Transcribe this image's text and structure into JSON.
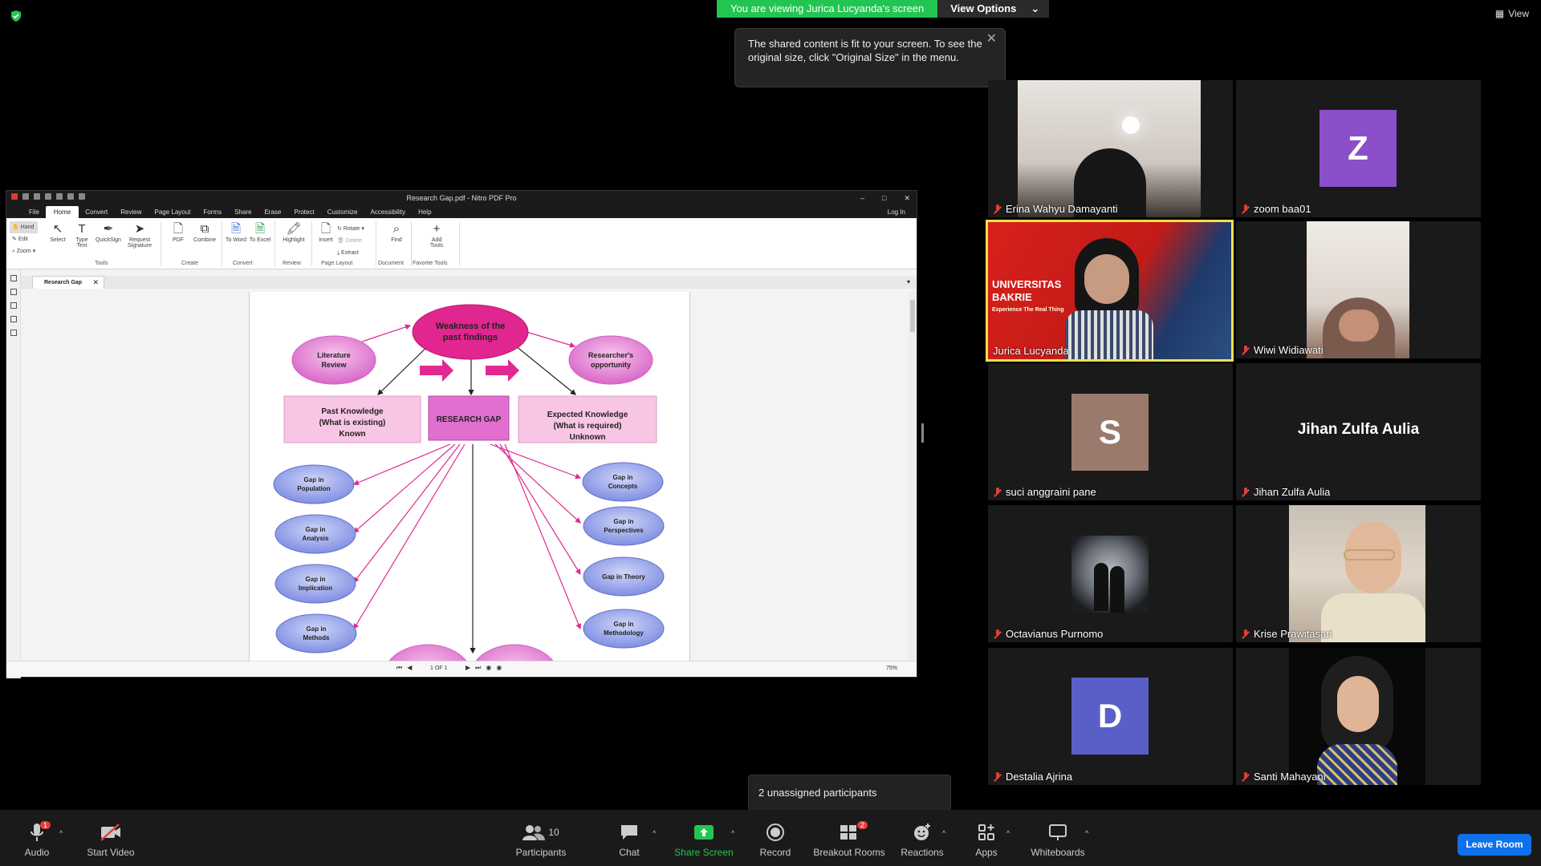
{
  "banner": {
    "viewing_text": "You are viewing Jurica Lucyanda's screen",
    "view_options": "View Options"
  },
  "tooltip": {
    "text": "The shared content is fit to your screen. To see the original size, click \"Original Size\" in the menu."
  },
  "top_right": {
    "view_label": "View"
  },
  "nitro": {
    "title": "Research Gap.pdf - Nitro PDF Pro",
    "menu": [
      "File",
      "Home",
      "Convert",
      "Review",
      "Page Layout",
      "Forms",
      "Share",
      "Erase",
      "Protect",
      "Customize",
      "Accessibility",
      "Help"
    ],
    "login": "Log In",
    "left_tools": [
      "Hand",
      "Edit",
      "Zoom"
    ],
    "ribbon": {
      "select": "Select",
      "type_text": "Type Text",
      "quicksign": "QuickSign",
      "request_signature": "Request Signature",
      "pdf": "PDF",
      "combine": "Combine",
      "to_word": "To Word",
      "to_excel": "To Excel",
      "highlight": "Highlight",
      "insert": "Insert",
      "rotate": "Rotate",
      "delete": "Delete",
      "extract": "Extract",
      "find": "Find",
      "add_tools": "Add Tools"
    },
    "groups": {
      "tools": "Tools",
      "create": "Create",
      "convert": "Convert",
      "review": "Review",
      "page_layout": "Page Layout",
      "document": "Document",
      "favorite_tools": "Favorite Tools"
    },
    "tab_name": "Research Gap",
    "page_indicator": "1 OF 1",
    "zoom": "75%",
    "diagram": {
      "weakness": [
        "Weakness of the",
        "past findings"
      ],
      "literature": [
        "Literature",
        "Review"
      ],
      "researcher": [
        "Researcher's",
        "opportunity"
      ],
      "past_knowledge": [
        "Past Knowledge",
        "(What is existing)",
        "Known"
      ],
      "research_gap": "RESEARCH GAP",
      "expected": [
        "Expected Knowledge",
        "(What is required)",
        "Unknown"
      ],
      "left_gaps": [
        [
          "Gap in",
          "Population"
        ],
        [
          "Gap in",
          "Analysis"
        ],
        [
          "Gap in",
          "Implication"
        ],
        [
          "Gap in",
          "Methods"
        ]
      ],
      "right_gaps": [
        [
          "Gap in",
          "Concepts"
        ],
        [
          "Gap in",
          "Perspectives"
        ],
        [
          "Gap in Theory"
        ],
        [
          "Gap in",
          "Methodology"
        ]
      ]
    }
  },
  "participants": [
    {
      "name": "Erina Wahyu Damayanti"
    },
    {
      "name": "zoom baa01",
      "initial": "Z",
      "color": "#8a4fc9"
    },
    {
      "name": "Jurica Lucyanda",
      "video_text": [
        "UNIVERSITAS",
        "BAKRIE",
        "Experience The Real Thing"
      ],
      "speaking": true
    },
    {
      "name": "Wiwi Widiawati"
    },
    {
      "name": "suci anggraini pane",
      "initial": "S",
      "color": "#9b7a6e"
    },
    {
      "name": "Jihan Zulfa Aulia",
      "big": "Jihan Zulfa Aulia"
    },
    {
      "name": "Octavianus Purnomo"
    },
    {
      "name": "Krise Prawitasari"
    },
    {
      "name": "Destalia Ajrina",
      "initial": "D",
      "color": "#5a5fc7"
    },
    {
      "name": "Santi Mahayani"
    }
  ],
  "unassigned": "2 unassigned participants",
  "toolbar": {
    "audio": "Audio",
    "audio_badge": "1",
    "start_video": "Start Video",
    "participants": "Participants",
    "participants_count": "10",
    "chat": "Chat",
    "share_screen": "Share Screen",
    "record": "Record",
    "breakout_rooms": "Breakout Rooms",
    "breakout_badge": "2",
    "reactions": "Reactions",
    "apps": "Apps",
    "whiteboards": "Whiteboards",
    "leave_room": "Leave Room"
  },
  "colors": {
    "banner_green": "#23c552",
    "speaker_border": "#f4e04d",
    "leave_blue": "#0e71eb",
    "share_green": "#23c552"
  }
}
